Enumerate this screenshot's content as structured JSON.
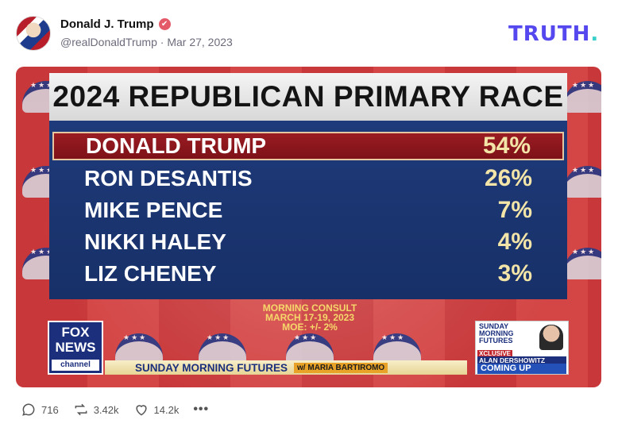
{
  "post": {
    "display_name": "Donald J. Trump",
    "handle": "@realDonaldTrump",
    "separator": "·",
    "date": "Mar 27, 2023"
  },
  "brand": {
    "logo_text": "TRUTH",
    "logo_dot": "."
  },
  "graphic": {
    "title": "2024 REPUBLICAN PRIMARY RACE",
    "rows": [
      {
        "name": "DONALD TRUMP",
        "pct": "54%"
      },
      {
        "name": "RON DESANTIS",
        "pct": "26%"
      },
      {
        "name": "MIKE PENCE",
        "pct": "7%"
      },
      {
        "name": "NIKKI HALEY",
        "pct": "4%"
      },
      {
        "name": "LIZ CHENEY",
        "pct": "3%"
      }
    ],
    "source_line1": "MORNING CONSULT",
    "source_line2": "MARCH 17-19, 2023",
    "source_line3": "MOE: +/- 2%",
    "network_l1": "FOX",
    "network_l2": "NEWS",
    "network_l3": "channel",
    "show_name": "SUNDAY MORNING FUTURES",
    "host": "w/ MARIA BARTIROMO",
    "promo_show": "SUNDAY MORNING FUTURES",
    "promo_exclusive": "XCLUSIVE",
    "promo_guest": "ALAN DERSHOWITZ",
    "promo_coming": "COMING UP"
  },
  "actions": {
    "replies": "716",
    "retruths": "3.42k",
    "likes": "14.2k",
    "more": "•••"
  },
  "colors": {
    "brand_purple": "#5448ee",
    "brand_teal": "#38d0c8",
    "verified_badge": "#e45a68",
    "panel_blue": "#1f3a7a",
    "highlight_red": "#9a1c22"
  },
  "icons": [
    "verified-badge-icon",
    "reply-icon",
    "retruth-icon",
    "like-icon",
    "more-icon"
  ]
}
